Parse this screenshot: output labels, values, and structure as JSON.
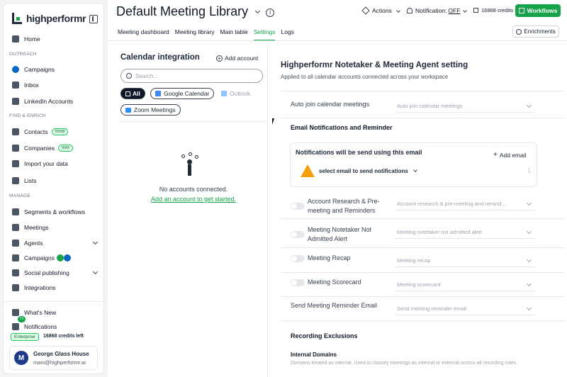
{
  "brand": {
    "name": "highperformr"
  },
  "sidebar": {
    "home": "Home",
    "outreach_label": "OUTREACH",
    "campaigns": "Campaigns",
    "inbox": "Inbox",
    "linkedin": "LinkedIn Accounts",
    "find_label": "FIND & ENRICH",
    "contacts": "Contacts",
    "contacts_badge": "550M",
    "companies": "Companies",
    "companies_badge": "50M",
    "import": "Import your data",
    "lists": "Lists",
    "manage_label": "MANAGE",
    "segments": "Segments & workflows",
    "meetings": "Meetings",
    "agents": "Agents",
    "campaigns2": "Campaigns",
    "social": "Social publishing",
    "integrations": "Integrations",
    "whats_new": "What's New",
    "notifications": "Notifications",
    "notif_count": "71",
    "plan": "Enterprise",
    "credits": "16868 credits left",
    "user_initial": "M",
    "user_name": "George Glass House",
    "user_email": "mani@highperformr.ai"
  },
  "header": {
    "title": "Default Meeting Library",
    "actions": "Actions",
    "notification": "Notification: ",
    "notification_state": "OFF",
    "credits": "16868 credits",
    "workflows": "Workflows",
    "enrichments": "Enrichments"
  },
  "tabs": [
    "Meeting dashboard",
    "Meeting library",
    "Main table",
    "Settings",
    "Logs"
  ],
  "calendar": {
    "title": "Calendar integration",
    "add_account": "Add account",
    "search_placeholder": "Search...",
    "filters": [
      "All",
      "Google Calendar",
      "Outlook",
      "Zoom Meetings"
    ],
    "empty": "No accounts connected.",
    "empty_link": "Add an account to get started."
  },
  "settings": {
    "title": "Highperformr Notetaker & Meeting Agent setting",
    "subtitle": "Applied to all calendar accounts connected across your workspace",
    "auto_join": "Auto join calendar meetings",
    "auto_join_ph": "Auto join calendar meetings",
    "email_section": "Email Notifications and Reminder",
    "notif_box_title": "Notifications will be send using this email",
    "add_email": "Add email",
    "select_email": "select email to send notifications",
    "research": "Account Research & Pre-meeting and Reminders",
    "research_ph": "Account research & pre-meeting and remind...",
    "not_admitted": "Meeting Notetaker Not Admitted Alert",
    "not_admitted_ph": "Meeting notetaker not admitted alert",
    "recap": "Meeting Recap",
    "recap_ph": "Meeting recap",
    "scorecard": "Meeting Scorecard",
    "scorecard_ph": "Meeting scorecard",
    "reminder": "Send Meeting Reminder Email",
    "reminder_ph": "Send meeting reminder email",
    "recording_section": "Recording Exclusions",
    "internal_domains": "Internal Domains",
    "internal_desc": "Domains treated as internal. Used to classify meetings as internal or external across all recording rules."
  }
}
